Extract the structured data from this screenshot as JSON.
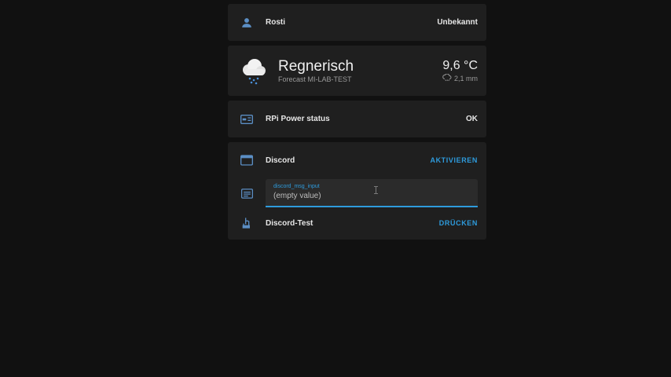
{
  "person": {
    "name": "Rosti",
    "state": "Unbekannt",
    "icon": "account-icon"
  },
  "weather": {
    "condition": "Regnerisch",
    "forecast_name": "Forecast MI-LAB-TEST",
    "temperature": "9,6 °C",
    "precipitation": "2,1 mm",
    "icon": "rainy-cloud-icon"
  },
  "rpi": {
    "name": "RPi Power status",
    "state": "OK",
    "icon": "power-card-icon"
  },
  "discord": {
    "name": "Discord",
    "action": "AKTIVIEREN",
    "icon": "window-icon"
  },
  "msg_input": {
    "label": "discord_msg_input",
    "value": "(empty value)",
    "icon": "text-box-icon"
  },
  "discord_test": {
    "name": "Discord-Test",
    "action": "DRÜCKEN",
    "icon": "gesture-tap-icon"
  },
  "colors": {
    "accent": "#2e9bdc",
    "card": "#1f1f1f",
    "background": "#111111"
  }
}
